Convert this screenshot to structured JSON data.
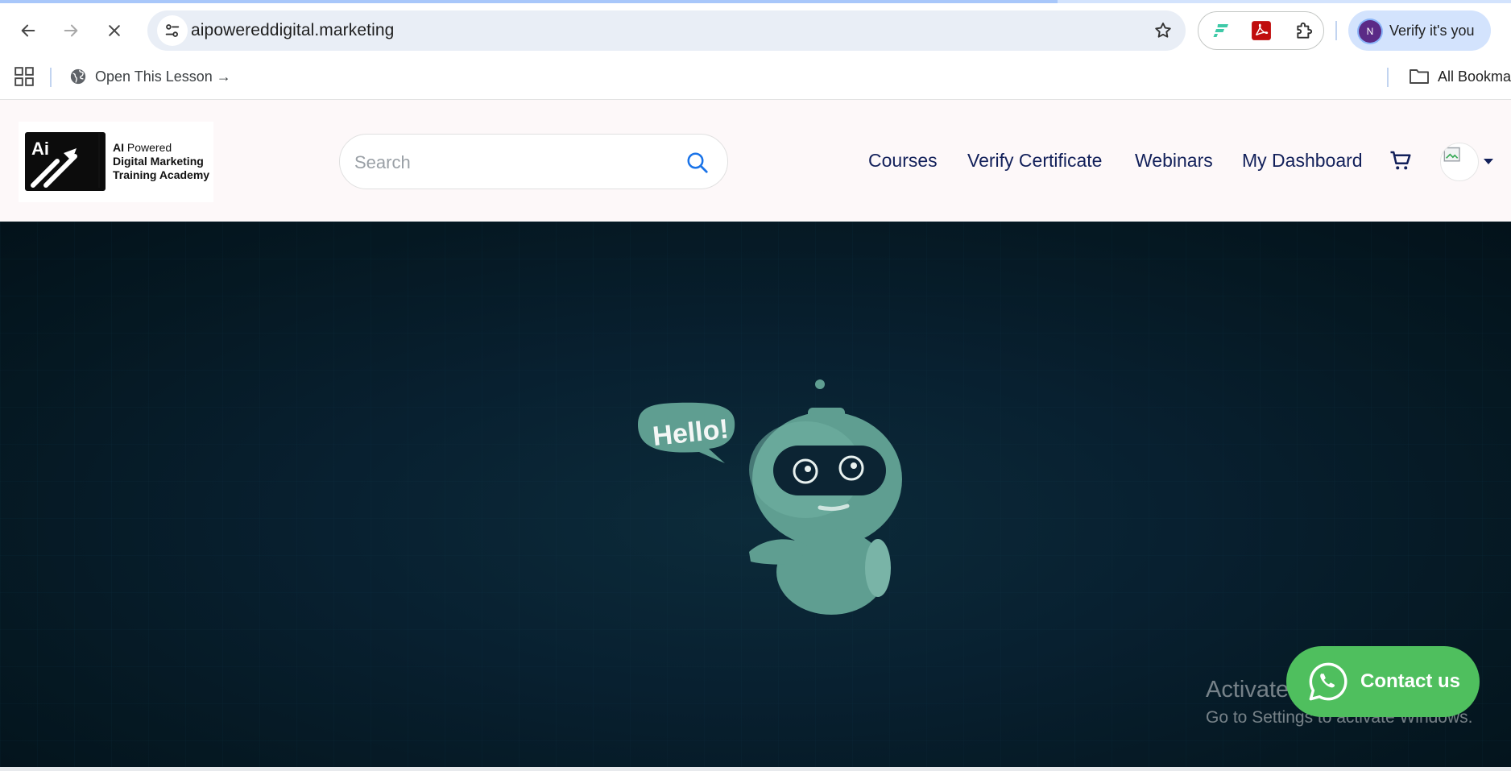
{
  "browser": {
    "url": "aipowereddigital.marketing",
    "profile_label": "Verify it's you",
    "profile_initial": "N",
    "bookmark_item": "Open This Lesson →",
    "all_bookmarks": "All Bookma",
    "load_progress": 0.7
  },
  "site": {
    "logo": {
      "mark_text": "Ai",
      "line1_bold": "AI",
      "line1_rest": " Powered",
      "line2": "Digital Marketing",
      "line3": "Training Academy"
    },
    "search_placeholder": "Search",
    "nav": {
      "courses": "Courses",
      "verify_certificate": "Verify Certificate",
      "webinars": "Webinars",
      "my_dashboard": "My Dashboard"
    }
  },
  "hero": {
    "bubble_text": "Hello!",
    "contact_label": "Contact us"
  },
  "os_overlay": {
    "line1": "Activate Windows",
    "line2": "Go to Settings to activate Windows."
  },
  "colors": {
    "nav_text": "#12205a",
    "whatsapp_green": "#4fbf5e",
    "robot_teal": "#5f9e91",
    "hero_bg": "#061b26"
  }
}
